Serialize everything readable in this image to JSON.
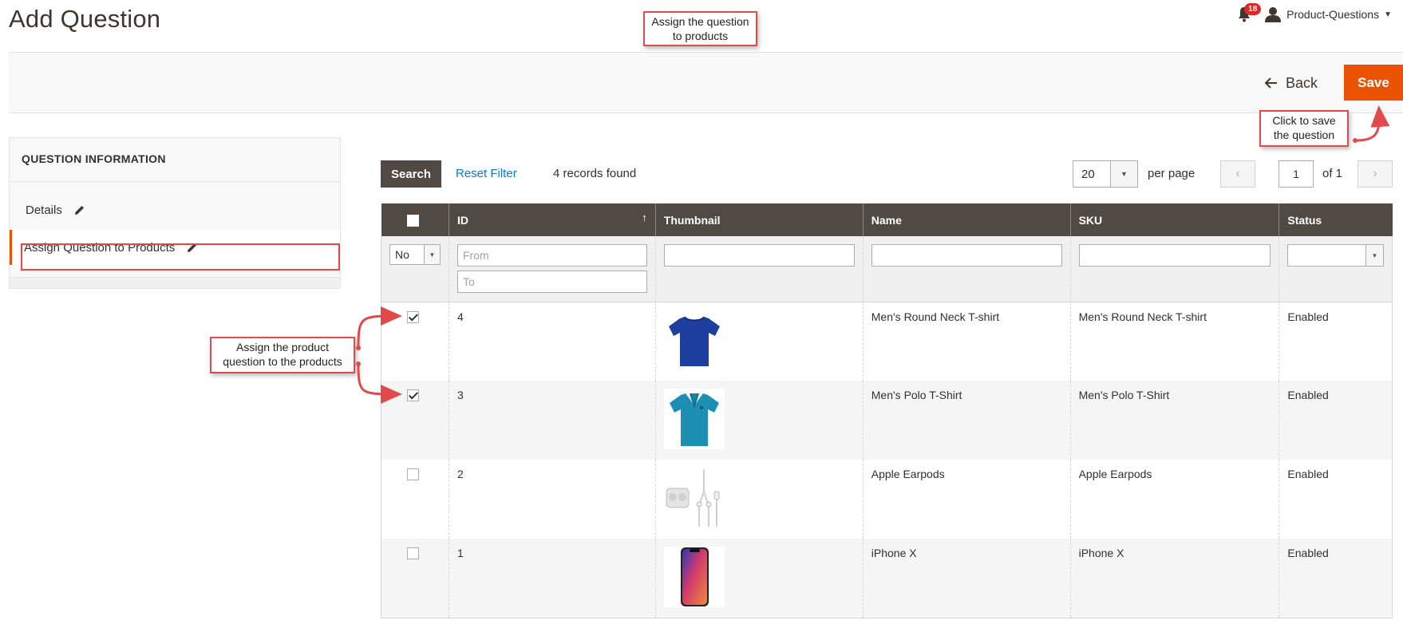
{
  "page": {
    "title": "Add Question"
  },
  "header": {
    "notifications_count": "18",
    "user_name": "Product-Questions"
  },
  "callouts": {
    "assign_top": "Assign the question to products",
    "save": "Click to save the question",
    "assign_left": "Assign the product question to the products"
  },
  "toolbar": {
    "back_label": "Back",
    "save_label": "Save"
  },
  "sidebar": {
    "title": "QUESTION INFORMATION",
    "items": [
      {
        "label": "Details",
        "active": false
      },
      {
        "label": "Assign Question to Products",
        "active": true
      }
    ]
  },
  "grid": {
    "search_label": "Search",
    "reset_label": "Reset Filter",
    "records_text": "4 records found",
    "per_page_value": "20",
    "per_page_label": "per page",
    "page_value": "1",
    "page_of": "of 1",
    "columns": [
      "ID",
      "Thumbnail",
      "Name",
      "SKU",
      "Status"
    ],
    "filters": {
      "in_products_value": "No",
      "id_from_placeholder": "From",
      "id_to_placeholder": "To"
    },
    "rows": [
      {
        "checked": true,
        "id": "4",
        "thumbnail": "blue-round-neck-tshirt",
        "name": "Men's Round Neck T-shirt",
        "sku": "Men's Round Neck T-shirt",
        "status": "Enabled"
      },
      {
        "checked": true,
        "id": "3",
        "thumbnail": "teal-polo-tshirt",
        "name": "Men's Polo T-Shirt",
        "sku": "Men's Polo T-Shirt",
        "status": "Enabled"
      },
      {
        "checked": false,
        "id": "2",
        "thumbnail": "apple-earpods",
        "name": "Apple Earpods",
        "sku": "Apple Earpods",
        "status": "Enabled"
      },
      {
        "checked": false,
        "id": "1",
        "thumbnail": "iphone-x",
        "name": "iPhone X",
        "sku": "iPhone X",
        "status": "Enabled"
      }
    ]
  },
  "colors": {
    "accent": "#eb5202",
    "header_bg": "#514943",
    "callout_border": "#e04a4a",
    "link": "#007bdb"
  }
}
